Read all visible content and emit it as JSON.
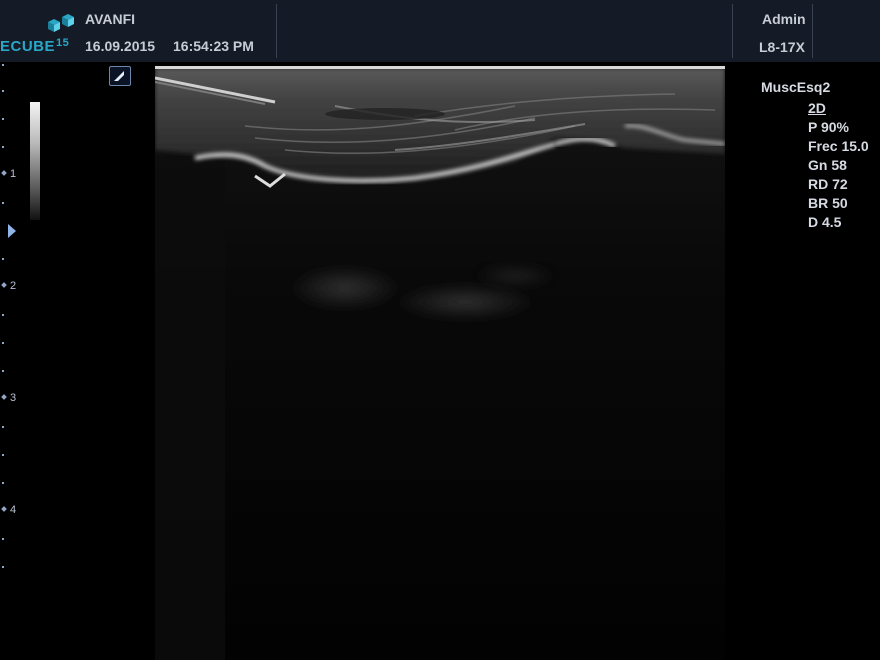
{
  "header": {
    "logo_text": "ECUBE",
    "logo_superscript": "15",
    "patient_name": "AVANFI",
    "date": "16.09.2015",
    "time": "16:54:23 PM",
    "operator": "Admin",
    "probe": "L8-17X"
  },
  "depth_scale": {
    "labels": [
      "1",
      "2",
      "3",
      "4"
    ]
  },
  "parameters": {
    "preset": "MuscEsq2",
    "mode": "2D",
    "power": "P 90%",
    "frequency": "Frec 15.0",
    "gain": "Gn 58",
    "dynamic_range": "RD 72",
    "brightness": "BR 50",
    "depth": "D 4.5"
  },
  "icons": {
    "orientation": "orientation-marker-icon",
    "logo": "ecube-cubes-icon",
    "focus": "focus-marker-icon"
  },
  "colors": {
    "header_bg": "#141a26",
    "logo_accent": "#2aa7c6",
    "scale_accent": "#8fa7c8"
  }
}
